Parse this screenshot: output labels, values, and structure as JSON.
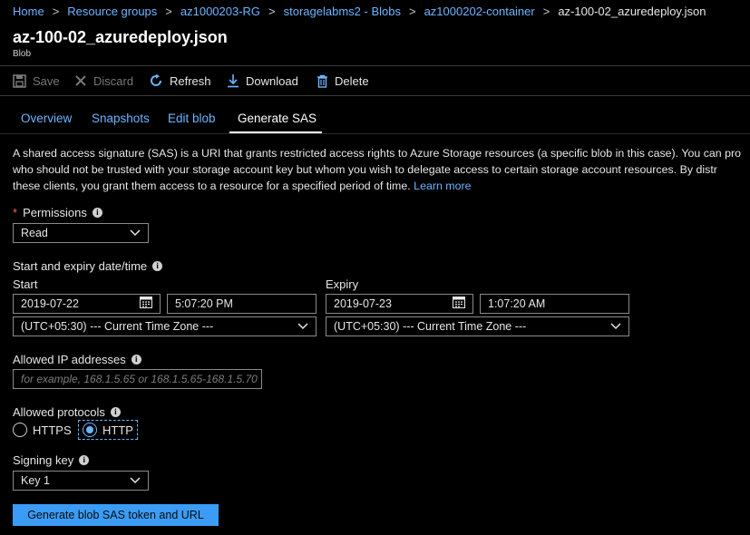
{
  "breadcrumb": {
    "items": [
      "Home",
      "Resource groups",
      "az1000203-RG",
      "storagelabms2 - Blobs",
      "az1000202-container"
    ],
    "current": "az-100-02_azuredeploy.json"
  },
  "header": {
    "title": "az-100-02_azuredeploy.json",
    "subtitle": "Blob"
  },
  "toolbar": {
    "save": "Save",
    "discard": "Discard",
    "refresh": "Refresh",
    "download": "Download",
    "delete": "Delete"
  },
  "tabs": [
    "Overview",
    "Snapshots",
    "Edit blob",
    "Generate SAS"
  ],
  "active_tab": "Generate SAS",
  "description": {
    "line1": "A shared access signature (SAS) is a URI that grants restricted access rights to Azure Storage resources (a specific blob in this case). You can pro",
    "line2": "who should not be trusted with your storage account key but whom you wish to delegate access to certain storage account resources. By distr",
    "line3": "these clients, you grant them access to a resource for a specified period of time.",
    "learn_more": "Learn more"
  },
  "permissions": {
    "label": "Permissions",
    "value": "Read"
  },
  "dates": {
    "label": "Start and expiry date/time",
    "start_label": "Start",
    "start_date": "2019-07-22",
    "start_time": "5:07:20 PM",
    "start_tz": "(UTC+05:30) --- Current Time Zone ---",
    "expiry_label": "Expiry",
    "expiry_date": "2019-07-23",
    "expiry_time": "1:07:20 AM",
    "expiry_tz": "(UTC+05:30) --- Current Time Zone ---"
  },
  "ip": {
    "label": "Allowed IP addresses",
    "placeholder": "for example, 168.1.5.65 or 168.1.5.65-168.1.5.70"
  },
  "protocols": {
    "label": "Allowed protocols",
    "options": [
      "HTTPS",
      "HTTP"
    ],
    "selected": "HTTP"
  },
  "signing": {
    "label": "Signing key",
    "value": "Key 1"
  },
  "action": {
    "label": "Generate blob SAS token and URL"
  },
  "colors": {
    "accent": "#6cb4ff",
    "button": "#3b9cf5",
    "background": "#000000"
  }
}
